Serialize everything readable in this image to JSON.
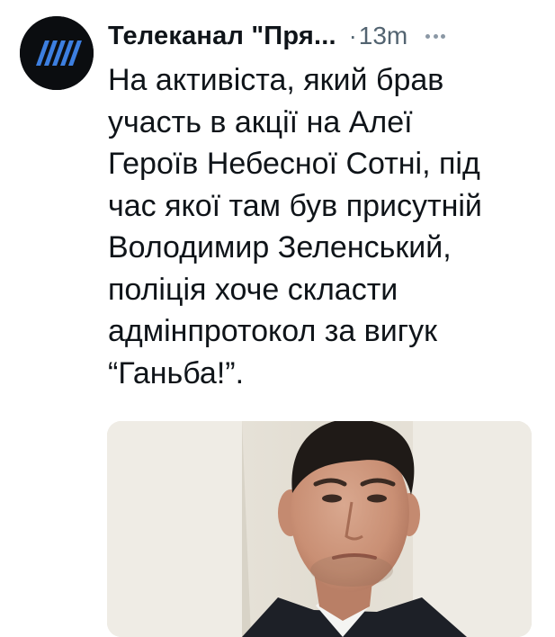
{
  "tweet": {
    "author_name": "Телеканал \"Пря...",
    "separator": "·",
    "time_ago": "13m",
    "text_lines": [
      "На активіста, який брав",
      "участь в акції на Алеї",
      "Героїв Небесної Сотні, під",
      "час якої там був присутній",
      "Володимир Зеленський,",
      "поліція хоче скласти",
      "адмінпротокол за вигук",
      "“Ганьба!”."
    ]
  },
  "colors": {
    "text_primary": "#0f1419",
    "text_secondary": "#536471",
    "avatar_bg": "#0b0d10",
    "avatar_stripes": "#3d7fe0"
  },
  "icons": {
    "avatar": "channel-logo-stripes-icon",
    "more": "more-horizontal-icon"
  }
}
